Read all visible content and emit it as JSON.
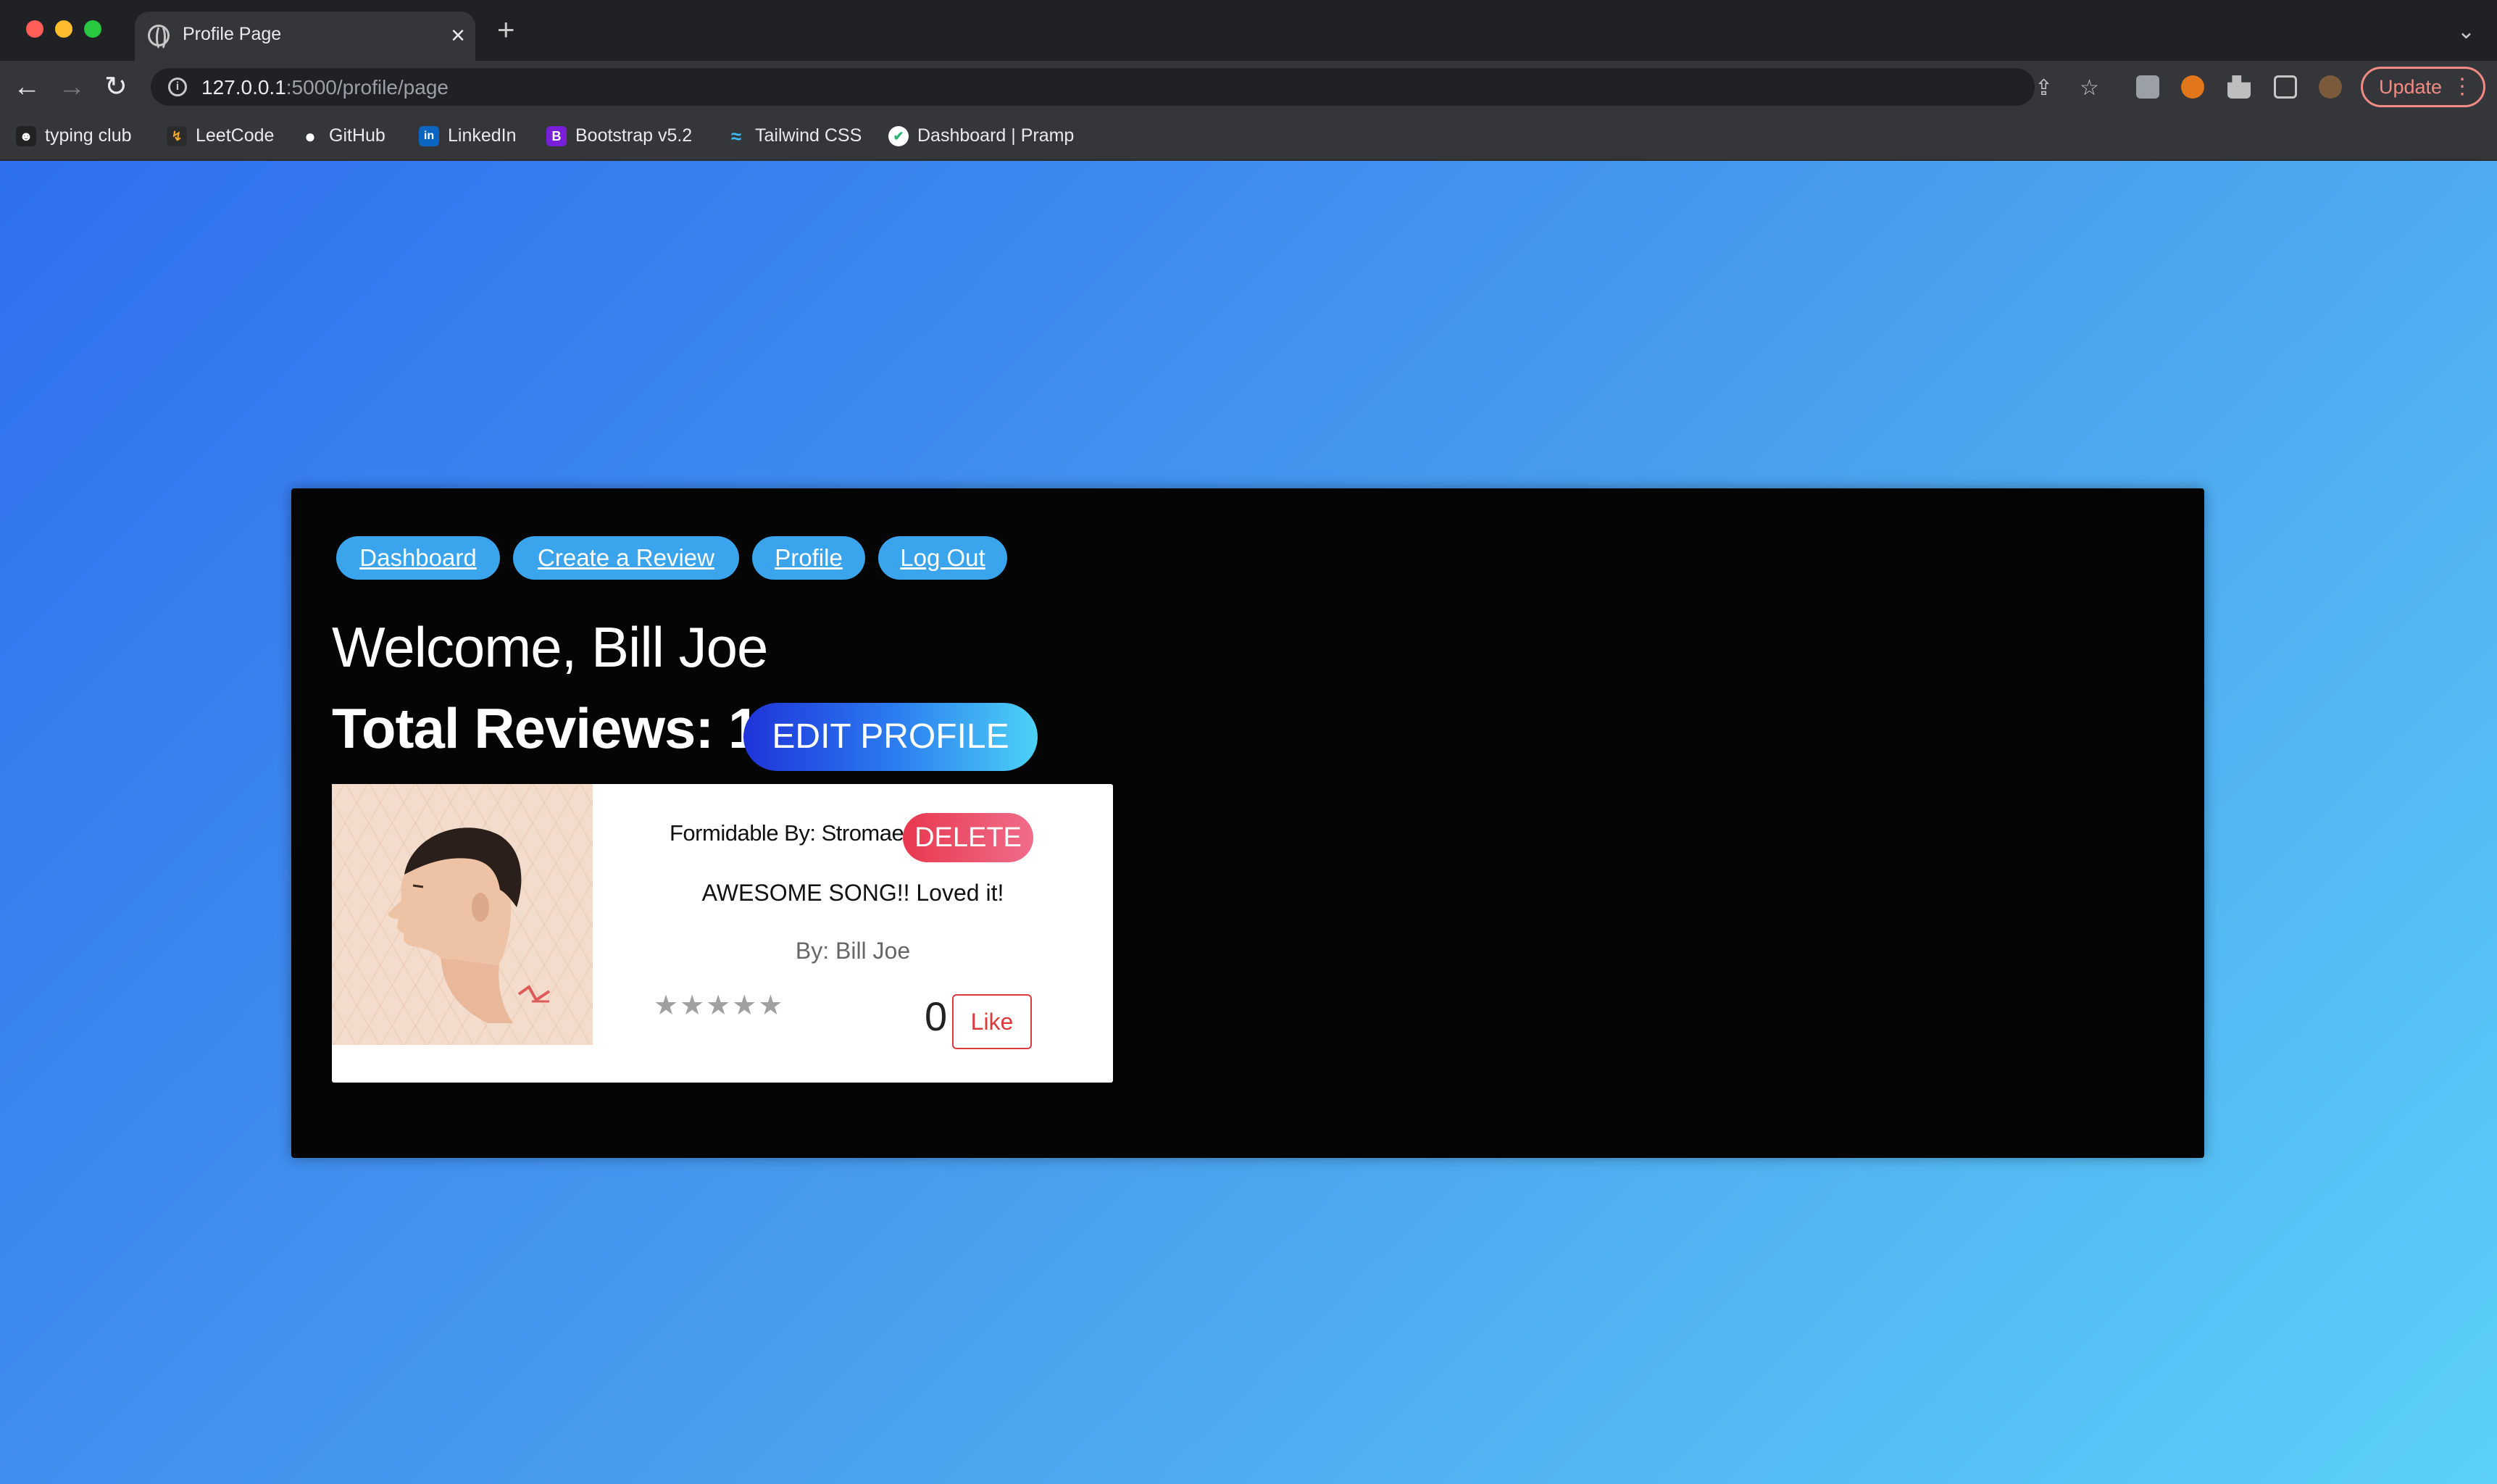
{
  "browser": {
    "tab_title": "Profile Page",
    "tab_close": "×",
    "new_tab": "+",
    "tab_menu": "⌄",
    "url_host": "127.0.0.1",
    "url_path": ":5000/profile/page",
    "update_label": "Update",
    "update_menu": "⋮",
    "nav": {
      "back": "←",
      "forward": "→",
      "reload": "↻"
    },
    "omnibox_icons": {
      "share": "⇪",
      "bookmark_star": "☆"
    },
    "bookmarks": [
      {
        "label": "typing club",
        "icon": "typingclub-icon",
        "color": "#222222",
        "glyph": "☻"
      },
      {
        "label": "LeetCode",
        "icon": "leetcode-icon",
        "color": "#2b2b2b",
        "glyph": "↯"
      },
      {
        "label": "GitHub",
        "icon": "github-icon",
        "color": "#ffffff",
        "glyph": "●"
      },
      {
        "label": "LinkedIn",
        "icon": "linkedin-icon",
        "color": "#0a66c2",
        "glyph": "in"
      },
      {
        "label": "Bootstrap v5.2",
        "icon": "bootstrap-icon",
        "color": "#7a1fd8",
        "glyph": "B"
      },
      {
        "label": "Tailwind CSS",
        "icon": "tailwind-icon",
        "color": "#38bdf8",
        "glyph": "≈"
      },
      {
        "label": "Dashboard | Pramp",
        "icon": "pramp-icon",
        "color": "#ffffff",
        "glyph": "✔"
      }
    ]
  },
  "page": {
    "nav": {
      "dashboard": "Dashboard",
      "create_review": "Create a Review",
      "profile": "Profile",
      "logout": "Log Out"
    },
    "welcome": "Welcome, Bill Joe",
    "total_reviews": "Total Reviews: 1",
    "edit_profile": "EDIT PROFILE",
    "review_card": {
      "song": "Formidable By: Stromae",
      "delete_label": "DELETE",
      "review_text": "AWESOME SONG!! Loved it!",
      "author": "By: Bill Joe",
      "rating_stars": 5,
      "rating_filled": 0,
      "like_count": "0",
      "like_label": "Like"
    }
  },
  "colors": {
    "page_gradient_start": "#2f6ff0",
    "page_gradient_end": "#5bd0f8",
    "panel_bg": "#050505",
    "pill_bg": "#3aa4ec",
    "delete_red": "#e8384f",
    "like_red": "#d93a3a"
  }
}
